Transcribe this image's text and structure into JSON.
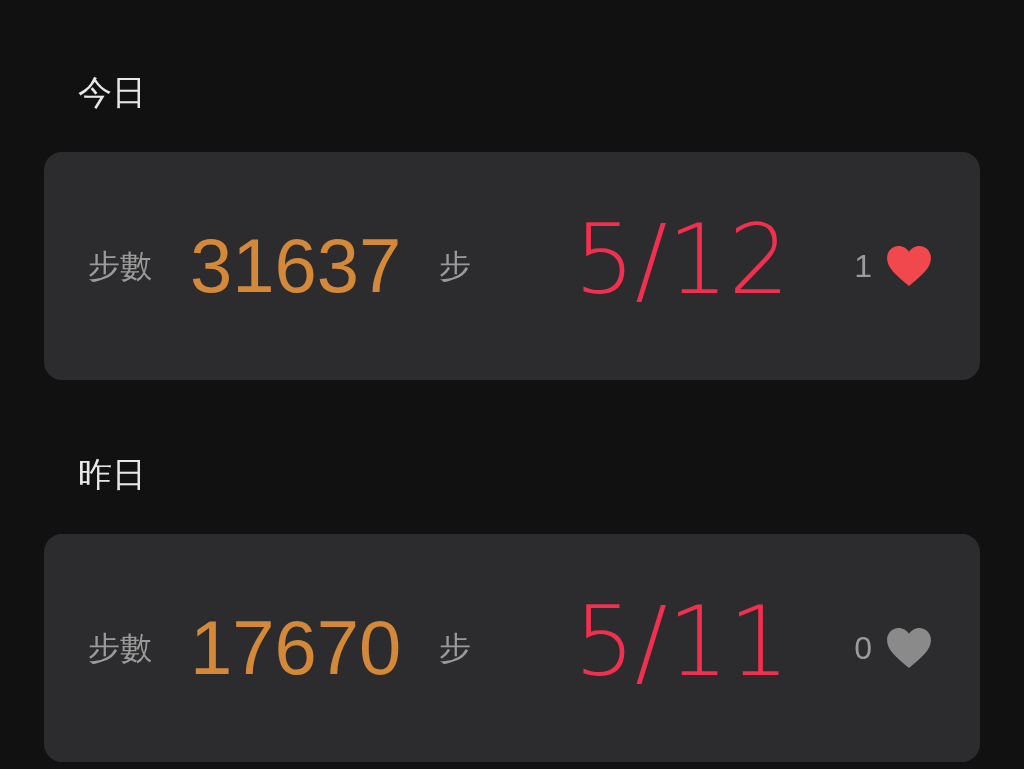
{
  "days": [
    {
      "title": "今日",
      "label": "步數",
      "steps": "31637",
      "unit": "步",
      "likes": "1",
      "liked": true,
      "annotation": "5/12"
    },
    {
      "title": "昨日",
      "label": "步數",
      "steps": "17670",
      "unit": "步",
      "likes": "0",
      "liked": false,
      "annotation": "5/11"
    }
  ]
}
